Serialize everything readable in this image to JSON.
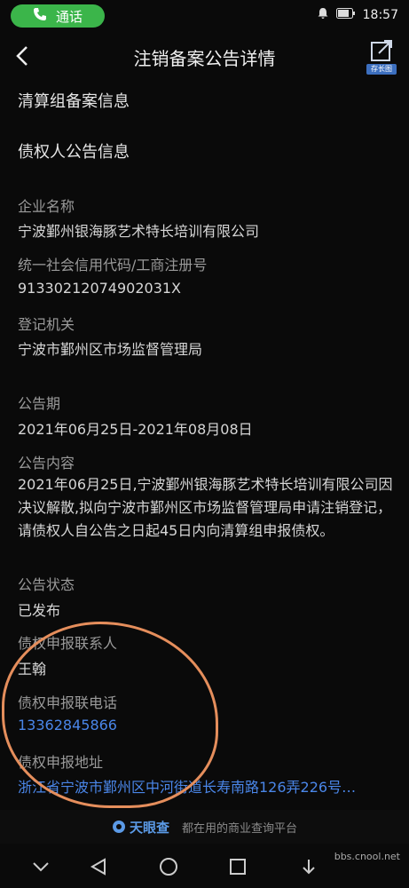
{
  "status": {
    "call_label": "通话",
    "time": "18:57"
  },
  "header": {
    "title": "注销备案公告详情",
    "share_badge": "存长图"
  },
  "sections": {
    "liquidation": "清算组备案信息",
    "creditor_notice": "债权人公告信息"
  },
  "fields": {
    "company_name_label": "企业名称",
    "company_name": "宁波鄞州银海豚艺术特长培训有限公司",
    "credit_code_label": "统一社会信用代码/工商注册号",
    "credit_code": "91330212074902031X",
    "authority_label": "登记机关",
    "authority": "宁波市鄞州区市场监督管理局",
    "period_label": "公告期",
    "period": "2021年06月25日-2021年08月08日",
    "content_label": "公告内容",
    "content": "2021年06月25日,宁波鄞州银海豚艺术特长培训有限公司因决议解散,拟向宁波市鄞州区市场监督管理局申请注销登记，请债权人自公告之日起45日内向清算组申报债权。",
    "status_label": "公告状态",
    "status": "已发布",
    "contact_label": "债权申报联系人",
    "contact": "王翰",
    "phone_label": "债权申报联电话",
    "phone": "13362845866",
    "address_label": "债权申报地址",
    "address": "浙江省宁波市鄞州区中河街道长寿南路126弄226号…"
  },
  "footer": {
    "brand": "天眼查",
    "slogan": "都在用的商业查询平台"
  },
  "watermark": "bbs.cnool.net"
}
